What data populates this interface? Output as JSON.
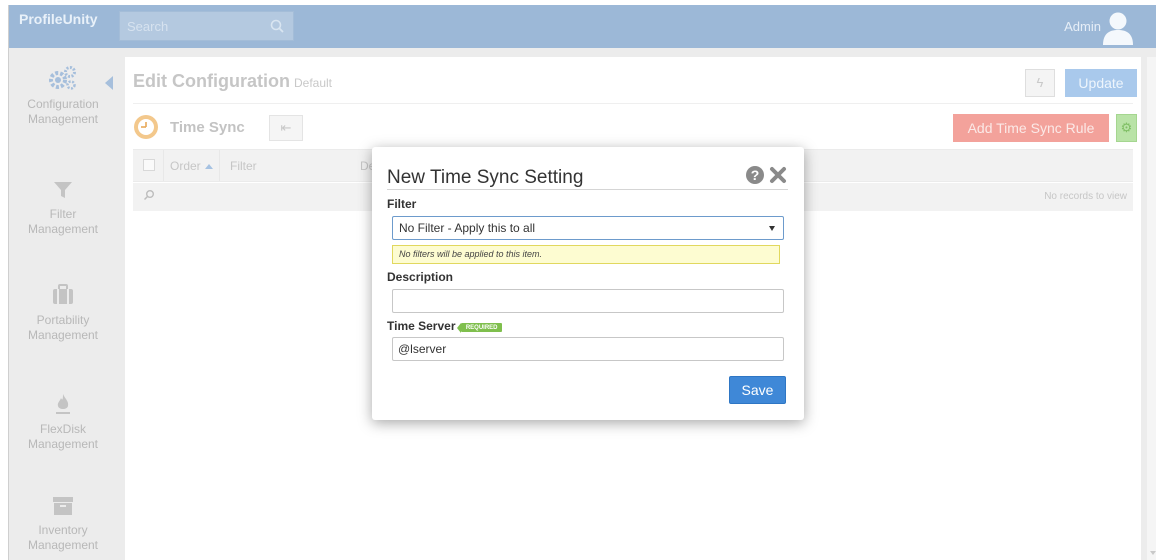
{
  "app": {
    "brand": "ProfileUnity"
  },
  "search": {
    "placeholder": "Search"
  },
  "user": {
    "name": "Admin"
  },
  "sidebar": {
    "items": [
      {
        "label_line1": "Configuration",
        "label_line2": "Management",
        "icon": "gears-icon"
      },
      {
        "label_line1": "Filter",
        "label_line2": "Management",
        "icon": "funnel-icon"
      },
      {
        "label_line1": "Portability",
        "label_line2": "Management",
        "icon": "briefcase-icon"
      },
      {
        "label_line1": "FlexDisk",
        "label_line2": "Management",
        "icon": "flame-icon"
      },
      {
        "label_line1": "Inventory",
        "label_line2": "Management",
        "icon": "archive-box-icon"
      }
    ]
  },
  "page": {
    "title": "Edit Configuration",
    "subtitle": "Default",
    "update_label": "Update",
    "section_title": "Time Sync",
    "add_rule_label": "Add Time Sync Rule"
  },
  "grid": {
    "columns": [
      "Order",
      "Filter",
      "Des"
    ],
    "empty_text": "No records to view"
  },
  "modal": {
    "title": "New Time Sync Setting",
    "filter_label": "Filter",
    "filter_value": "No Filter - Apply this to all",
    "filter_hint": "No filters will be applied to this item.",
    "description_label": "Description",
    "description_value": "",
    "time_server_label": "Time Server",
    "required_badge": "REQUIRED",
    "time_server_value": "@lserver",
    "save_label": "Save"
  },
  "colors": {
    "topbar": "#9cb8d7",
    "save_button": "#3f88d7",
    "add_rule_button": "#f3a29b",
    "required_badge": "#7fbf4d",
    "hint_background": "#fdfcd1"
  }
}
